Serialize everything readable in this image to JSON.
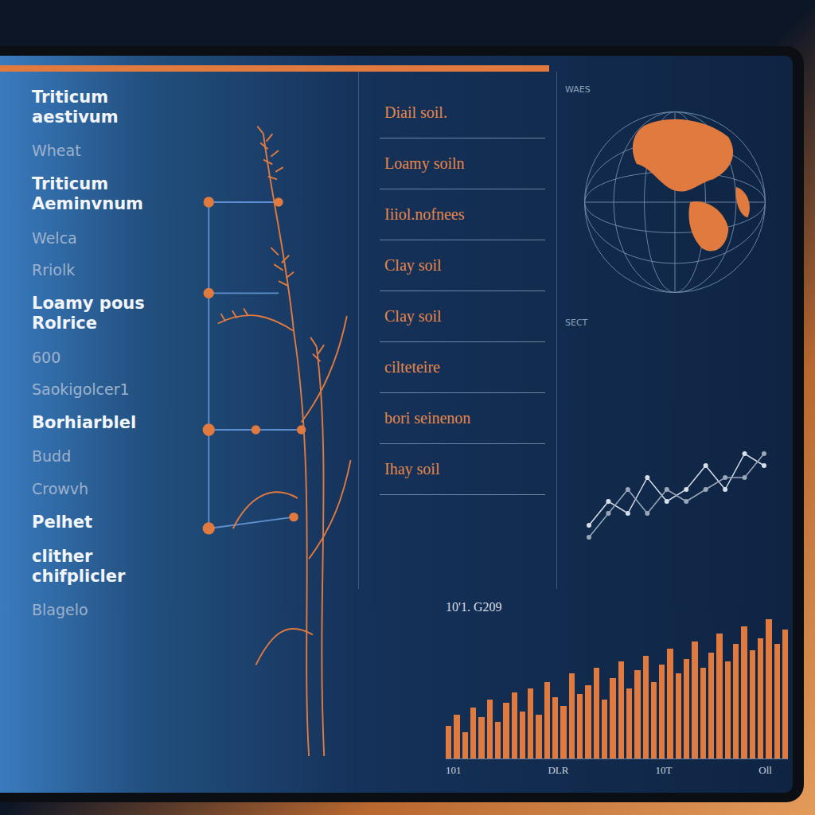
{
  "species_list": [
    {
      "label": "Triticum aestivum",
      "kind": "primary"
    },
    {
      "label": "Wheat",
      "kind": "muted"
    },
    {
      "label": "Triticum Aeminvnum",
      "kind": "primary"
    },
    {
      "label": "Welca",
      "kind": "muted"
    },
    {
      "label": "Rriolk",
      "kind": "muted"
    },
    {
      "label": "Loamy pous Rolrice",
      "kind": "primary"
    },
    {
      "label": "600",
      "kind": "muted"
    },
    {
      "label": "Saokigolcer1",
      "kind": "muted"
    },
    {
      "label": "Borhiarblel",
      "kind": "primary"
    },
    {
      "label": "Budd",
      "kind": "muted"
    },
    {
      "label": "Crowvh",
      "kind": "muted"
    },
    {
      "label": "Pelhet",
      "kind": "primary"
    },
    {
      "label": "clither chifplicler",
      "kind": "primary"
    },
    {
      "label": "Blagelo",
      "kind": "muted"
    }
  ],
  "soil_list": [
    "Diail soil.",
    "Loamy soiln",
    "Iiiol.nofnees",
    "Clay soil",
    "Clay soil",
    "cilteteire",
    "bori seinenon",
    "Ihay soil"
  ],
  "map": {
    "label": "WAES",
    "caption": "SECT"
  },
  "line_chart": {
    "series": [
      {
        "values": [
          2,
          4,
          3,
          6,
          4,
          5,
          7,
          5,
          8,
          7
        ]
      },
      {
        "values": [
          1,
          3,
          5,
          3,
          5,
          4,
          5,
          6,
          6,
          8
        ]
      }
    ]
  },
  "bar_chart": {
    "title": "10'1. G209",
    "ticks": [
      "101",
      "DLR",
      "10T",
      "Oll"
    ],
    "values": [
      22,
      30,
      18,
      35,
      28,
      40,
      25,
      38,
      45,
      32,
      48,
      30,
      52,
      42,
      36,
      58,
      44,
      50,
      62,
      40,
      55,
      66,
      48,
      60,
      70,
      52,
      64,
      75,
      58,
      68,
      80,
      62,
      72,
      85,
      66,
      78,
      90,
      74,
      82,
      95,
      78,
      88
    ]
  }
}
